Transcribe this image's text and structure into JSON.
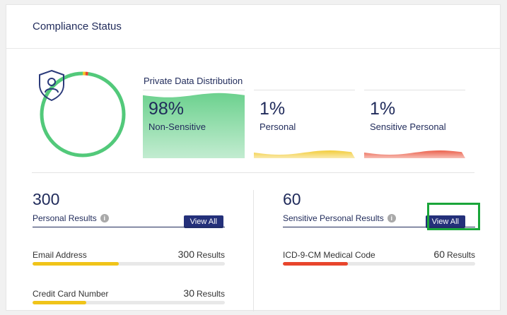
{
  "header": {
    "title": "Compliance Status"
  },
  "ring": {
    "icon": "shield-user-icon",
    "segments": [
      {
        "color": "#52c97a",
        "fraction": 0.98
      },
      {
        "color": "#f0c419",
        "fraction": 0.01
      },
      {
        "color": "#e8452c",
        "fraction": 0.01
      }
    ]
  },
  "distribution": {
    "title": "Private Data Distribution",
    "panels": [
      {
        "percent": "98%",
        "label": "Non-Sensitive",
        "color": "#52c97a",
        "level": 0.98
      },
      {
        "percent": "1%",
        "label": "Personal",
        "color": "#f0c419",
        "level": 0.01
      },
      {
        "percent": "1%",
        "label": "Sensitive Personal",
        "color": "#e8452c",
        "level": 0.01
      }
    ]
  },
  "personal": {
    "count": "300",
    "label": "Personal Results",
    "button": "View All",
    "rows": [
      {
        "name": "Email Address",
        "value": "300",
        "unit": "Results",
        "fill": 0.45,
        "color": "#f0c419"
      },
      {
        "name": "Credit Card Number",
        "value": "30",
        "unit": "Results",
        "fill": 0.28,
        "color": "#f0c419"
      }
    ]
  },
  "sensitive": {
    "count": "60",
    "label": "Sensitive Personal Results",
    "button": "View All",
    "rows": [
      {
        "name": "ICD-9-CM Medical Code",
        "value": "60",
        "unit": "Results",
        "fill": 0.34,
        "color": "#e8452c"
      }
    ]
  }
}
